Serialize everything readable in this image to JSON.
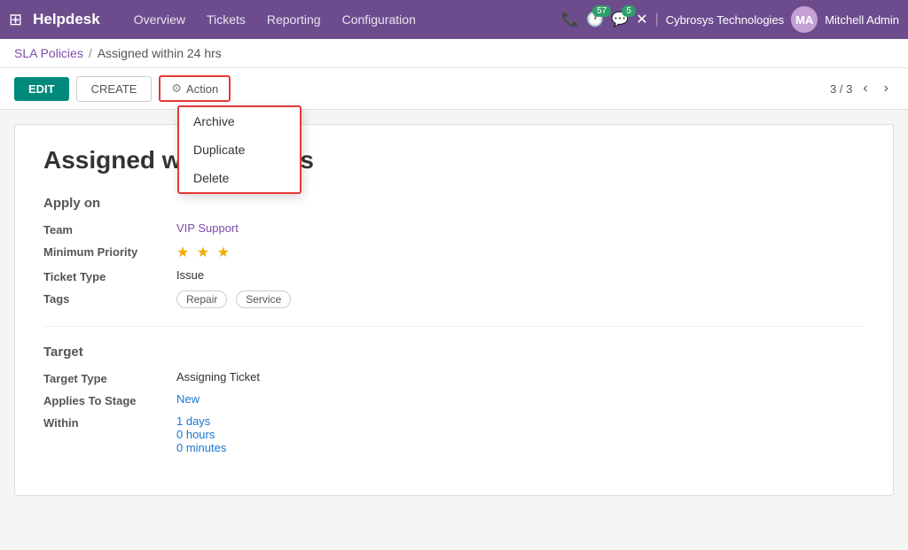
{
  "topnav": {
    "grid_icon": "⊞",
    "brand": "Helpdesk",
    "menu_items": [
      "Overview",
      "Tickets",
      "Reporting",
      "Configuration"
    ],
    "phone_icon": "📞",
    "clock_badge": "57",
    "chat_badge": "5",
    "close_icon": "✕",
    "company": "Cybrosys Technologies",
    "username": "Mitchell Admin",
    "avatar_initials": "MA"
  },
  "breadcrumb": {
    "parent": "SLA Policies",
    "separator": "/",
    "current": "Assigned within 24 hrs"
  },
  "toolbar": {
    "edit_label": "EDIT",
    "create_label": "CREATE",
    "action_label": "Action",
    "gear_icon": "⚙",
    "pagination": "3 / 3",
    "prev_icon": "‹",
    "next_icon": "›"
  },
  "dropdown": {
    "items": [
      "Archive",
      "Duplicate",
      "Delete"
    ]
  },
  "record": {
    "title": "Assigned within 24 hrs",
    "apply_on": {
      "section_title": "Apply on",
      "fields": [
        {
          "label": "Team",
          "value": "VIP Support",
          "type": "link"
        },
        {
          "label": "Minimum Priority",
          "value": "★ ★ ★",
          "type": "stars"
        },
        {
          "label": "Ticket Type",
          "value": "Issue",
          "type": "text"
        },
        {
          "label": "Tags",
          "value": [
            "Repair",
            "Service"
          ],
          "type": "tags"
        }
      ]
    },
    "target": {
      "section_title": "Target",
      "fields": [
        {
          "label": "Target Type",
          "value": "Assigning Ticket",
          "type": "text"
        },
        {
          "label": "Applies To Stage",
          "value": "New",
          "type": "blue"
        },
        {
          "label": "Within",
          "values": [
            "1  days",
            "0  hours",
            "0  minutes"
          ],
          "type": "multi"
        }
      ]
    }
  }
}
